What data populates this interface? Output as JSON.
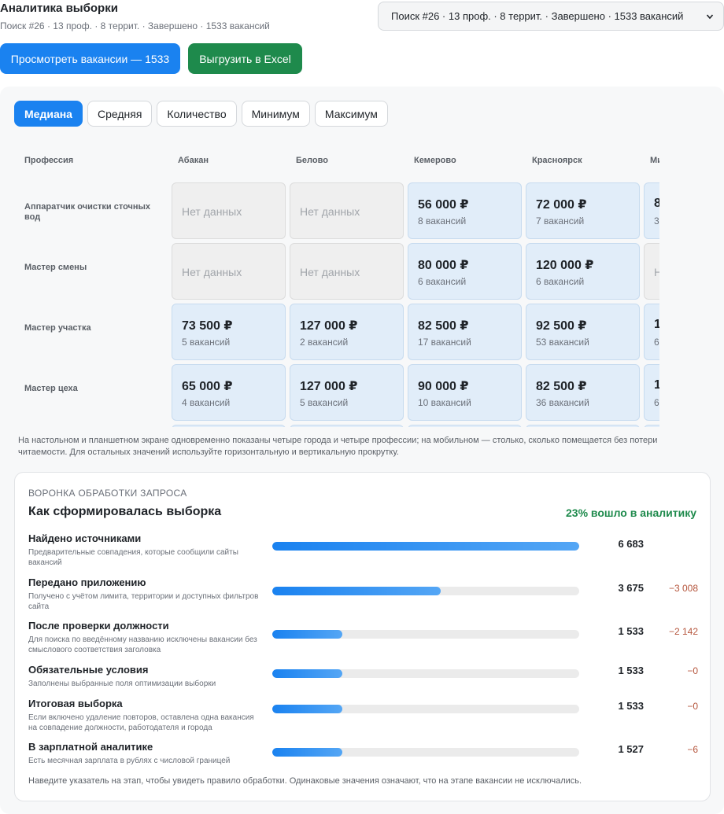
{
  "header": {
    "title": "Аналитика выборки",
    "subtitle": "Поиск #26 · 13 проф. · 8 террит. · Завершено · 1533 вакансий",
    "search_select_value": "Поиск #26 · 13 проф. · 8 террит. · Завершено · 1533 вакансий"
  },
  "actions": {
    "view_label": "Просмотреть вакансии — 1533",
    "excel_label": "Выгрузить в Excel"
  },
  "metric_tabs": [
    "Медиана",
    "Средняя",
    "Количество",
    "Минимум",
    "Максимум"
  ],
  "metric_active": "Медиана",
  "grid": {
    "profession_header": "Профессия",
    "cities": [
      "Абакан",
      "Белово",
      "Кемерово",
      "Красноярск",
      "Ми"
    ],
    "rows": [
      {
        "profession": "Аппаратчик очистки сточных вод",
        "cells": [
          {
            "empty": true,
            "text": "Нет данных"
          },
          {
            "empty": true,
            "text": "Нет данных"
          },
          {
            "price": "56 000 ₽",
            "count": "8 вакансий"
          },
          {
            "price": "72 000 ₽",
            "count": "7 вакансий"
          },
          {
            "price": "8",
            "count": "3"
          }
        ]
      },
      {
        "profession": "Мастер смены",
        "cells": [
          {
            "empty": true,
            "text": "Нет данных"
          },
          {
            "empty": true,
            "text": "Нет данных"
          },
          {
            "price": "80 000 ₽",
            "count": "6 вакансий"
          },
          {
            "price": "120 000 ₽",
            "count": "6 вакансий"
          },
          {
            "empty": true,
            "text": "Н"
          }
        ]
      },
      {
        "profession": "Мастер участка",
        "cells": [
          {
            "price": "73 500 ₽",
            "count": "5 вакансий"
          },
          {
            "price": "127 000 ₽",
            "count": "2 вакансий"
          },
          {
            "price": "82 500 ₽",
            "count": "17 вакансий"
          },
          {
            "price": "92 500 ₽",
            "count": "53 вакансий"
          },
          {
            "price": "1",
            "count": "6"
          }
        ]
      },
      {
        "profession": "Мастер цеха",
        "cells": [
          {
            "price": "65 000 ₽",
            "count": "4 вакансий"
          },
          {
            "price": "127 000 ₽",
            "count": "5 вакансий"
          },
          {
            "price": "90 000 ₽",
            "count": "10 вакансий"
          },
          {
            "price": "82 500 ₽",
            "count": "36 вакансий"
          },
          {
            "price": "1",
            "count": "6"
          }
        ]
      },
      {
        "profession": "",
        "cells": [
          {
            "price": "",
            "count": ""
          },
          {
            "price": "",
            "count": ""
          },
          {
            "price": "",
            "count": ""
          },
          {
            "price": "",
            "count": ""
          },
          {
            "price": "",
            "count": ""
          }
        ]
      }
    ],
    "note": "На настольном и планшетном экране одновременно показаны четыре города и четыре профессии; на мобильном — столько, сколько помещается без потери читаемости. Для остальных значений используйте горизонтальную и вертикальную прокрутку."
  },
  "funnel": {
    "label": "ВОРОНКА ОБРАБОТКИ ЗАПРОСА",
    "title": "Как сформировалась выборка",
    "percent_text": "23% вошло в аналитику",
    "max_value": 6683,
    "stages": [
      {
        "name": "Найдено источниками",
        "desc": "Предварительные совпадения, которые сообщили сайты вакансий",
        "value": 6683,
        "value_text": "6 683",
        "delta": ""
      },
      {
        "name": "Передано приложению",
        "desc": "Получено с учётом лимита, территории и доступных фильтров сайта",
        "value": 3675,
        "value_text": "3 675",
        "delta": "−3 008"
      },
      {
        "name": "После проверки должности",
        "desc": "Для поиска по введённому названию исключены вакансии без смыслового соответствия заголовка",
        "value": 1533,
        "value_text": "1 533",
        "delta": "−2 142"
      },
      {
        "name": "Обязательные условия",
        "desc": "Заполнены выбранные поля оптимизации выборки",
        "value": 1533,
        "value_text": "1 533",
        "delta": "−0"
      },
      {
        "name": "Итоговая выборка",
        "desc": "Если включено удаление повторов, оставлена одна вакансия на совпадение должности, работодателя и города",
        "value": 1533,
        "value_text": "1 533",
        "delta": "−0"
      },
      {
        "name": "В зарплатной аналитике",
        "desc": "Есть месячная зарплата в рублях с числовой границей",
        "value": 1527,
        "value_text": "1 527",
        "delta": "−6"
      }
    ],
    "hint": "Наведите указатель на этап, чтобы увидеть правило обработки. Одинаковые значения означают, что на этапе вакансии не исключались."
  }
}
